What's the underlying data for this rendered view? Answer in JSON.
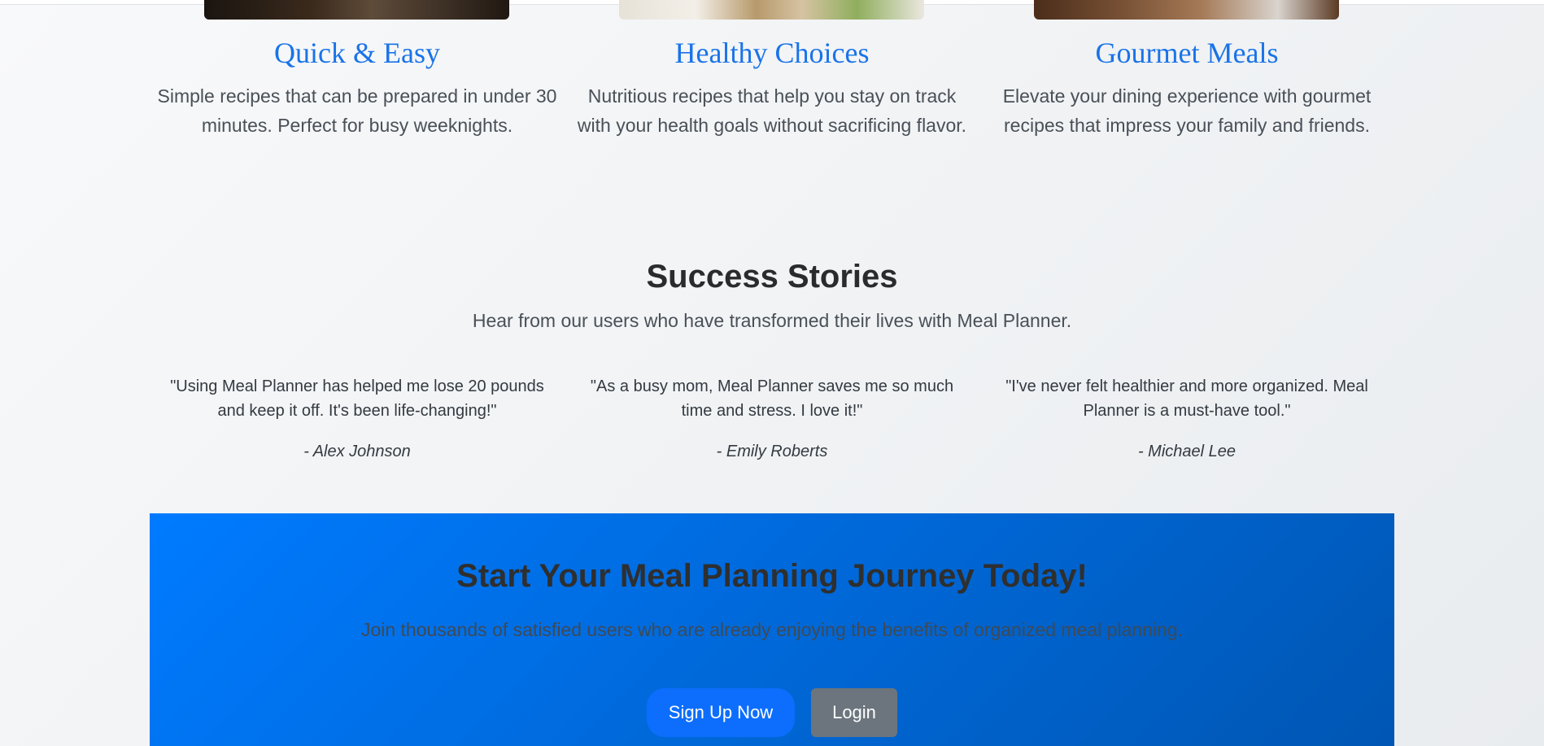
{
  "features": [
    {
      "title": "Quick & Easy",
      "description": "Simple recipes that can be prepared in under 30 minutes. Perfect for busy weeknights."
    },
    {
      "title": "Healthy Choices",
      "description": "Nutritious recipes that help you stay on track with your health goals without sacrificing flavor."
    },
    {
      "title": "Gourmet Meals",
      "description": "Elevate your dining experience with gourmet recipes that impress your family and friends."
    }
  ],
  "stories": {
    "title": "Success Stories",
    "subtitle": "Hear from our users who have transformed their lives with Meal Planner.",
    "testimonials": [
      {
        "quote": "\"Using Meal Planner has helped me lose 20 pounds and keep it off. It's been life-changing!\"",
        "author": "- Alex Johnson"
      },
      {
        "quote": "\"As a busy mom, Meal Planner saves me so much time and stress. I love it!\"",
        "author": "- Emily Roberts"
      },
      {
        "quote": "\"I've never felt healthier and more organized. Meal Planner is a must-have tool.\"",
        "author": "- Michael Lee"
      }
    ]
  },
  "cta": {
    "title": "Start Your Meal Planning Journey Today!",
    "text": "Join thousands of satisfied users who are already enjoying the benefits of organized meal planning.",
    "signup_label": "Sign Up Now",
    "login_label": "Login"
  },
  "colors": {
    "accent": "#1a73e8",
    "cta_start": "#007bff",
    "cta_end": "#0056b3",
    "signup_button": "#0d6efd",
    "login_button": "#6c757d"
  }
}
